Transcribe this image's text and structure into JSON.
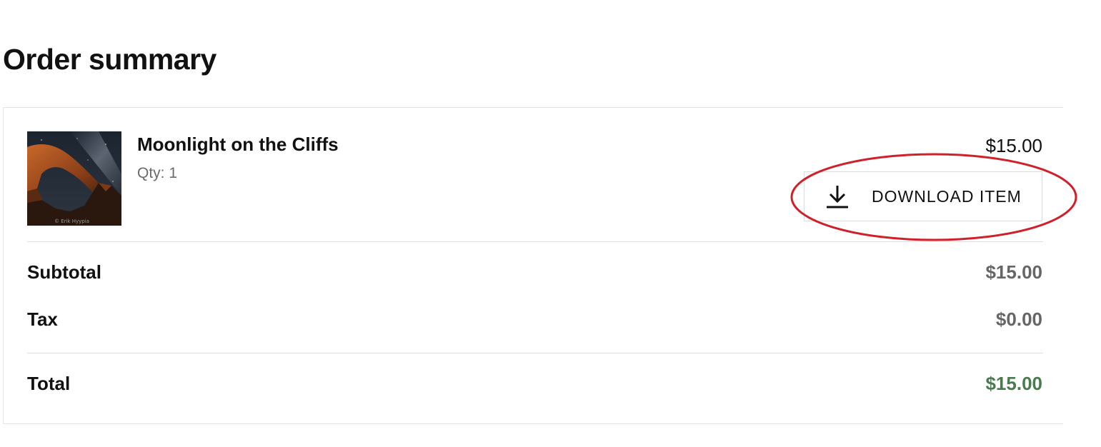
{
  "page": {
    "title": "Order summary"
  },
  "item": {
    "name": "Moonlight on the Cliffs",
    "qty": "Qty: 1",
    "price": "$15.00",
    "thumbnail": "night-sky-arch-photo",
    "watermark": "© Erik Hyypia",
    "download_label": "DOWNLOAD ITEM",
    "download_icon": "download-icon"
  },
  "totals": {
    "subtotal_label": "Subtotal",
    "subtotal_value": "$15.00",
    "tax_label": "Tax",
    "tax_value": "$0.00",
    "total_label": "Total",
    "total_value": "$15.00"
  },
  "colors": {
    "total_value": "#4a7a4e",
    "muted_value": "#666666",
    "highlight": "#d0202a"
  }
}
